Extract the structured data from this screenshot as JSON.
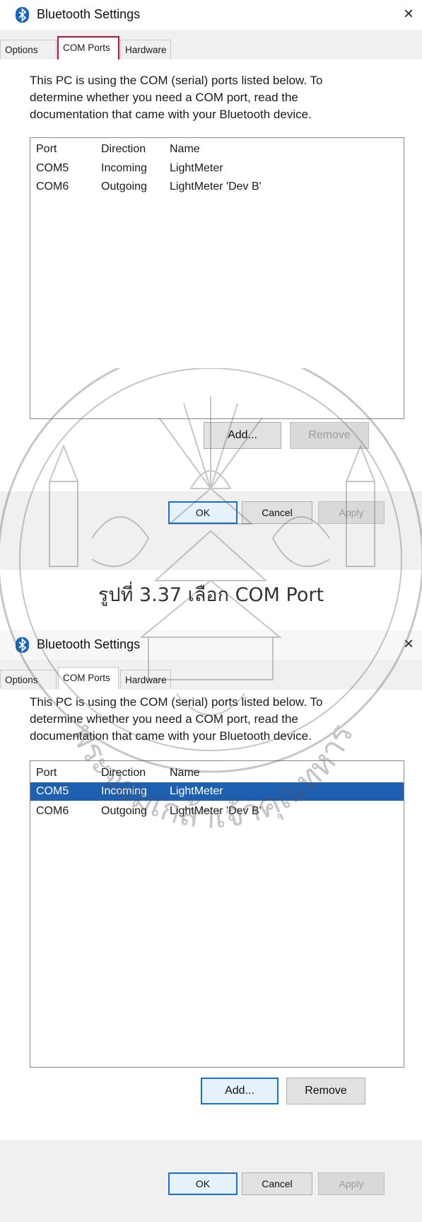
{
  "dialog1": {
    "title": "Bluetooth Settings",
    "close": "×",
    "tabs": [
      "Options",
      "COM Ports",
      "Hardware"
    ],
    "description": "This PC is using the COM (serial) ports listed below. To determine whether you need a COM port, read the documentation that came with your Bluetooth device.",
    "columns": {
      "port": "Port",
      "direction": "Direction",
      "name": "Name"
    },
    "rows": [
      {
        "port": "COM5",
        "direction": "Incoming",
        "name": "LightMeter"
      },
      {
        "port": "COM6",
        "direction": "Outgoing",
        "name": "LightMeter 'Dev B'"
      }
    ],
    "buttons": {
      "add": "Add...",
      "remove": "Remove",
      "ok": "OK",
      "cancel": "Cancel",
      "apply": "Apply"
    }
  },
  "caption": "รูปที่ 3.37 เลือก COM Port",
  "dialog2": {
    "title": "Bluetooth Settings",
    "close": "×",
    "tabs": [
      "Options",
      "COM Ports",
      "Hardware"
    ],
    "description": "This PC is using the COM (serial) ports listed below. To determine whether you need a COM port, read the documentation that came with your Bluetooth device.",
    "columns": {
      "port": "Port",
      "direction": "Direction",
      "name": "Name"
    },
    "rows": [
      {
        "port": "COM5",
        "direction": "Incoming",
        "name": "LightMeter",
        "selected": true
      },
      {
        "port": "COM6",
        "direction": "Outgoing",
        "name": "LightMeter 'Dev B'"
      }
    ],
    "buttons": {
      "add": "Add...",
      "remove": "Remove",
      "ok": "OK",
      "cancel": "Cancel",
      "apply": "Apply"
    }
  },
  "watermark_text": "พระจอมเกล้าเจ้าคุณทหาร",
  "colors": {
    "selection": "#1e5fb0",
    "highlight_box": "#c8102e",
    "bluetooth": "#1565c0",
    "default_button_border": "#1b70c9"
  },
  "icons": {
    "app": "bluetooth-icon",
    "close": "close-icon"
  }
}
